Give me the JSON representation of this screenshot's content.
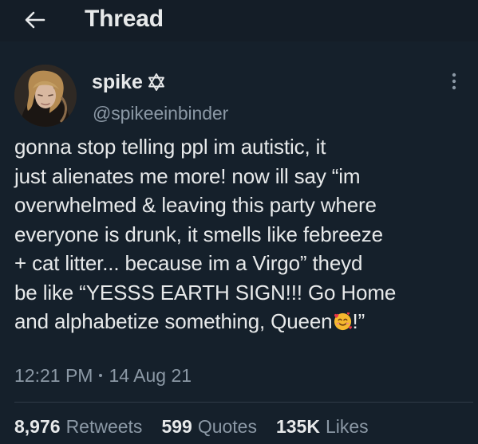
{
  "header": {
    "back_icon": "arrow-left-icon",
    "title": "Thread"
  },
  "author": {
    "display_name": "spike",
    "badge_icon": "star-of-david-icon",
    "handle": "@spikeeinbinder",
    "more_icon": "more-vertical-icon"
  },
  "tweet": {
    "lines": [
      "gonna stop telling ppl im autistic, it",
      "just alienates me more! now ill say “im",
      "overwhelmed & leaving this party where",
      "everyone is drunk, it smells like febreeze",
      "+ cat litter... because im a Virgo” theyd",
      "be like “YESSS EARTH SIGN!!! Go Home"
    ],
    "last_line_prefix": "and alphabetize something, Queen",
    "last_line_suffix": "!”",
    "emoji_icon": "smiling-face-with-hearts-icon"
  },
  "meta": {
    "time": "12:21 PM",
    "date": "14 Aug 21"
  },
  "stats": {
    "retweets_value": "8,976",
    "retweets_label": "Retweets",
    "quotes_value": "599",
    "quotes_label": "Quotes",
    "likes_value": "135K",
    "likes_label": "Likes"
  },
  "colors": {
    "background": "#15202b",
    "text_primary": "#e7e9ea",
    "text_secondary": "#8b98a5"
  }
}
